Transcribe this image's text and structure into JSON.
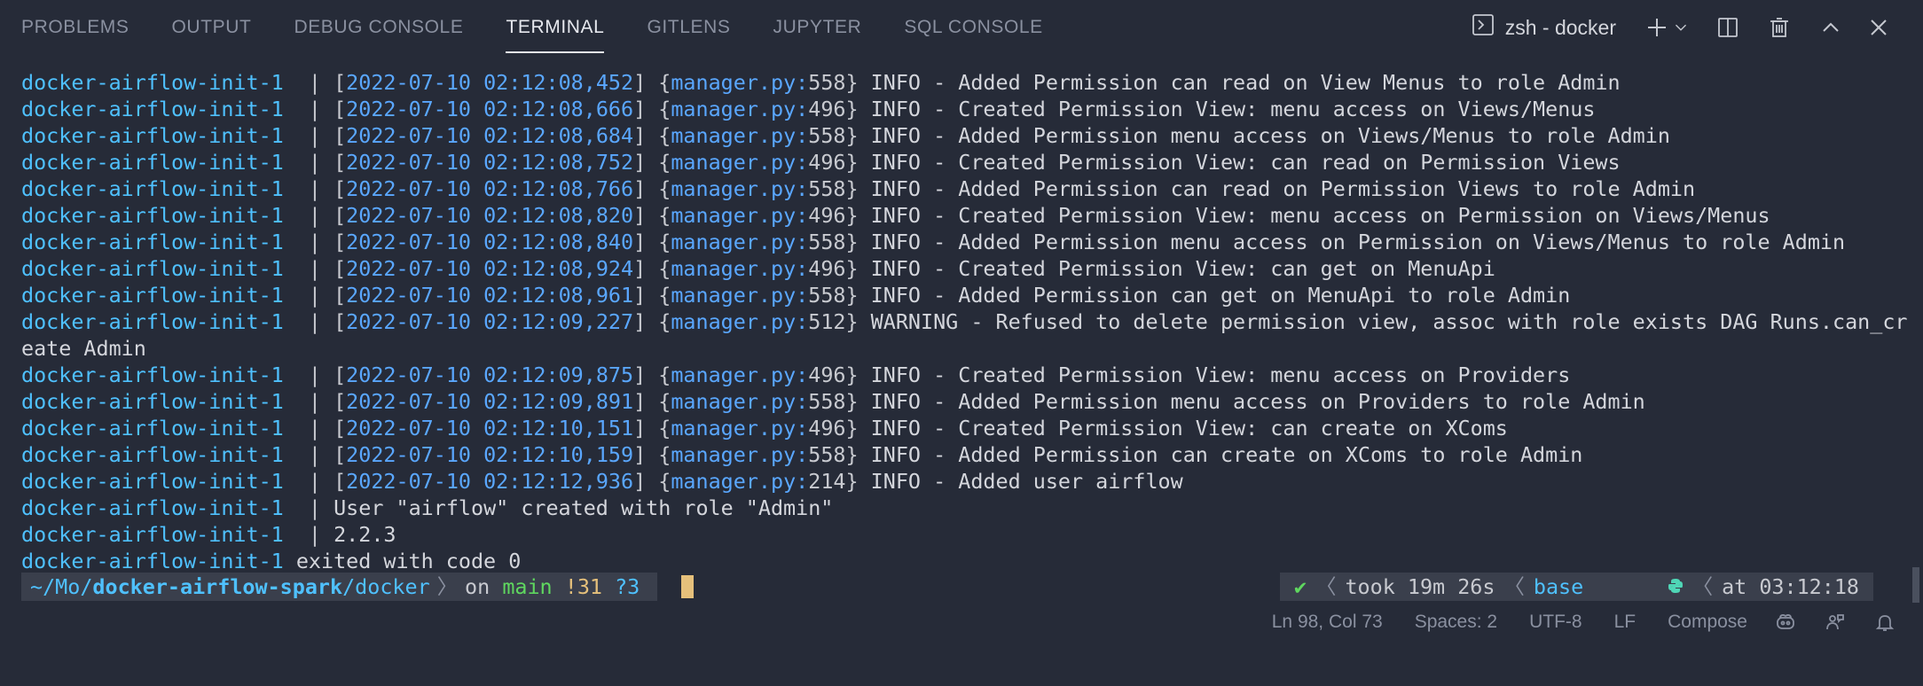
{
  "tabs": [
    {
      "label": "PROBLEMS"
    },
    {
      "label": "OUTPUT"
    },
    {
      "label": "DEBUG CONSOLE"
    },
    {
      "label": "TERMINAL",
      "active": true
    },
    {
      "label": "GITLENS"
    },
    {
      "label": "JUPYTER"
    },
    {
      "label": "SQL CONSOLE"
    }
  ],
  "terminal_name": "zsh - docker",
  "icons": {
    "terminal": "terminal-icon",
    "add": "plus-icon",
    "dropdown": "chevron-down-icon",
    "split": "split-icon",
    "trash": "trash-icon",
    "maximize": "chevron-up-icon",
    "close": "close-icon"
  },
  "log_lines": [
    {
      "svc": "docker-airflow-init-1",
      "ts": "2022-07-10 02:12:08,452",
      "mgr": "manager.py",
      "lineno": "558",
      "msg": " INFO - Added Permission can read on View Menus to role Admin"
    },
    {
      "svc": "docker-airflow-init-1",
      "ts": "2022-07-10 02:12:08,666",
      "mgr": "manager.py",
      "lineno": "496",
      "msg": " INFO - Created Permission View: menu access on Views/Menus"
    },
    {
      "svc": "docker-airflow-init-1",
      "ts": "2022-07-10 02:12:08,684",
      "mgr": "manager.py",
      "lineno": "558",
      "msg": " INFO - Added Permission menu access on Views/Menus to role Admin"
    },
    {
      "svc": "docker-airflow-init-1",
      "ts": "2022-07-10 02:12:08,752",
      "mgr": "manager.py",
      "lineno": "496",
      "msg": " INFO - Created Permission View: can read on Permission Views"
    },
    {
      "svc": "docker-airflow-init-1",
      "ts": "2022-07-10 02:12:08,766",
      "mgr": "manager.py",
      "lineno": "558",
      "msg": " INFO - Added Permission can read on Permission Views to role Admin"
    },
    {
      "svc": "docker-airflow-init-1",
      "ts": "2022-07-10 02:12:08,820",
      "mgr": "manager.py",
      "lineno": "496",
      "msg": " INFO - Created Permission View: menu access on Permission on Views/Menus"
    },
    {
      "svc": "docker-airflow-init-1",
      "ts": "2022-07-10 02:12:08,840",
      "mgr": "manager.py",
      "lineno": "558",
      "msg": " INFO - Added Permission menu access on Permission on Views/Menus to role Admin"
    },
    {
      "svc": "docker-airflow-init-1",
      "ts": "2022-07-10 02:12:08,924",
      "mgr": "manager.py",
      "lineno": "496",
      "msg": " INFO - Created Permission View: can get on MenuApi"
    },
    {
      "svc": "docker-airflow-init-1",
      "ts": "2022-07-10 02:12:08,961",
      "mgr": "manager.py",
      "lineno": "558",
      "msg": " INFO - Added Permission can get on MenuApi to role Admin"
    },
    {
      "svc": "docker-airflow-init-1",
      "ts": "2022-07-10 02:12:09,227",
      "mgr": "manager.py",
      "lineno": "512",
      "msg": " WARNING - Refused to delete permission view, assoc with role exists DAG Runs.can_cr"
    },
    {
      "plain": "eate Admin"
    },
    {
      "svc": "docker-airflow-init-1",
      "ts": "2022-07-10 02:12:09,875",
      "mgr": "manager.py",
      "lineno": "496",
      "msg": " INFO - Created Permission View: menu access on Providers"
    },
    {
      "svc": "docker-airflow-init-1",
      "ts": "2022-07-10 02:12:09,891",
      "mgr": "manager.py",
      "lineno": "558",
      "msg": " INFO - Added Permission menu access on Providers to role Admin"
    },
    {
      "svc": "docker-airflow-init-1",
      "ts": "2022-07-10 02:12:10,151",
      "mgr": "manager.py",
      "lineno": "496",
      "msg": " INFO - Created Permission View: can create on XComs"
    },
    {
      "svc": "docker-airflow-init-1",
      "ts": "2022-07-10 02:12:10,159",
      "mgr": "manager.py",
      "lineno": "558",
      "msg": " INFO - Added Permission can create on XComs to role Admin"
    },
    {
      "svc": "docker-airflow-init-1",
      "ts": "2022-07-10 02:12:12,936",
      "mgr": "manager.py",
      "lineno": "214",
      "msg": " INFO - Added user airflow"
    },
    {
      "svc": "docker-airflow-init-1",
      "text": "User \"airflow\" created with role \"Admin\""
    },
    {
      "svc": "docker-airflow-init-1",
      "text": "2.2.3"
    },
    {
      "exit_svc": "docker-airflow-init-1",
      "exit_text": " exited with code 0"
    }
  ],
  "prompt": {
    "path_prefix": "~/Mo/",
    "path_bold": "docker-airflow-spark",
    "path_suffix": "/docker",
    "on": "on",
    "branch": "main",
    "modified": "!31",
    "untracked": "?3",
    "check": "✔",
    "took": "took 19m 26s",
    "env": "base",
    "at": "at 03:12:18"
  },
  "status": {
    "position": "Ln 98, Col 73",
    "spaces": "Spaces: 2",
    "encoding": "UTF-8",
    "eol": "LF",
    "language": "Compose"
  }
}
